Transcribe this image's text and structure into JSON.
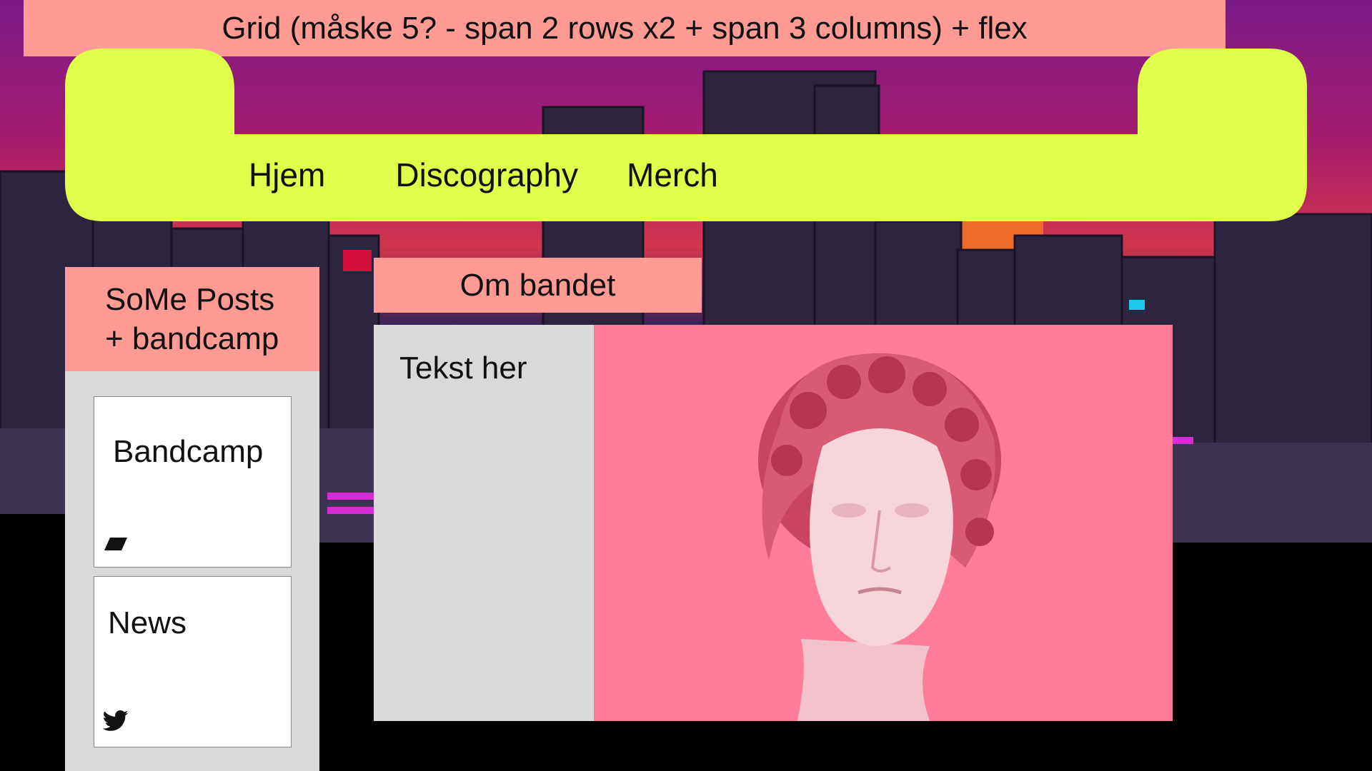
{
  "banner": {
    "title": "Grid (måske 5? - span 2 rows x2 + span 3 columns) + flex"
  },
  "nav": {
    "items": [
      "Hjem",
      "Discography",
      "Merch"
    ]
  },
  "sidebar": {
    "heading_line1": "SoMe Posts",
    "heading_line2": "+ bandcamp",
    "cards": [
      {
        "title": "Bandcamp",
        "icon": "bandcamp-icon"
      },
      {
        "title": "News",
        "icon": "twitter-icon"
      }
    ]
  },
  "main": {
    "heading": "Om bandet",
    "text": "Tekst her",
    "image": "statue-bust-image"
  },
  "colors": {
    "banner": "#ff9a94",
    "nav": "#dfff4a",
    "panel": "#d9d9d9",
    "image_bg": "#ff7d98"
  }
}
